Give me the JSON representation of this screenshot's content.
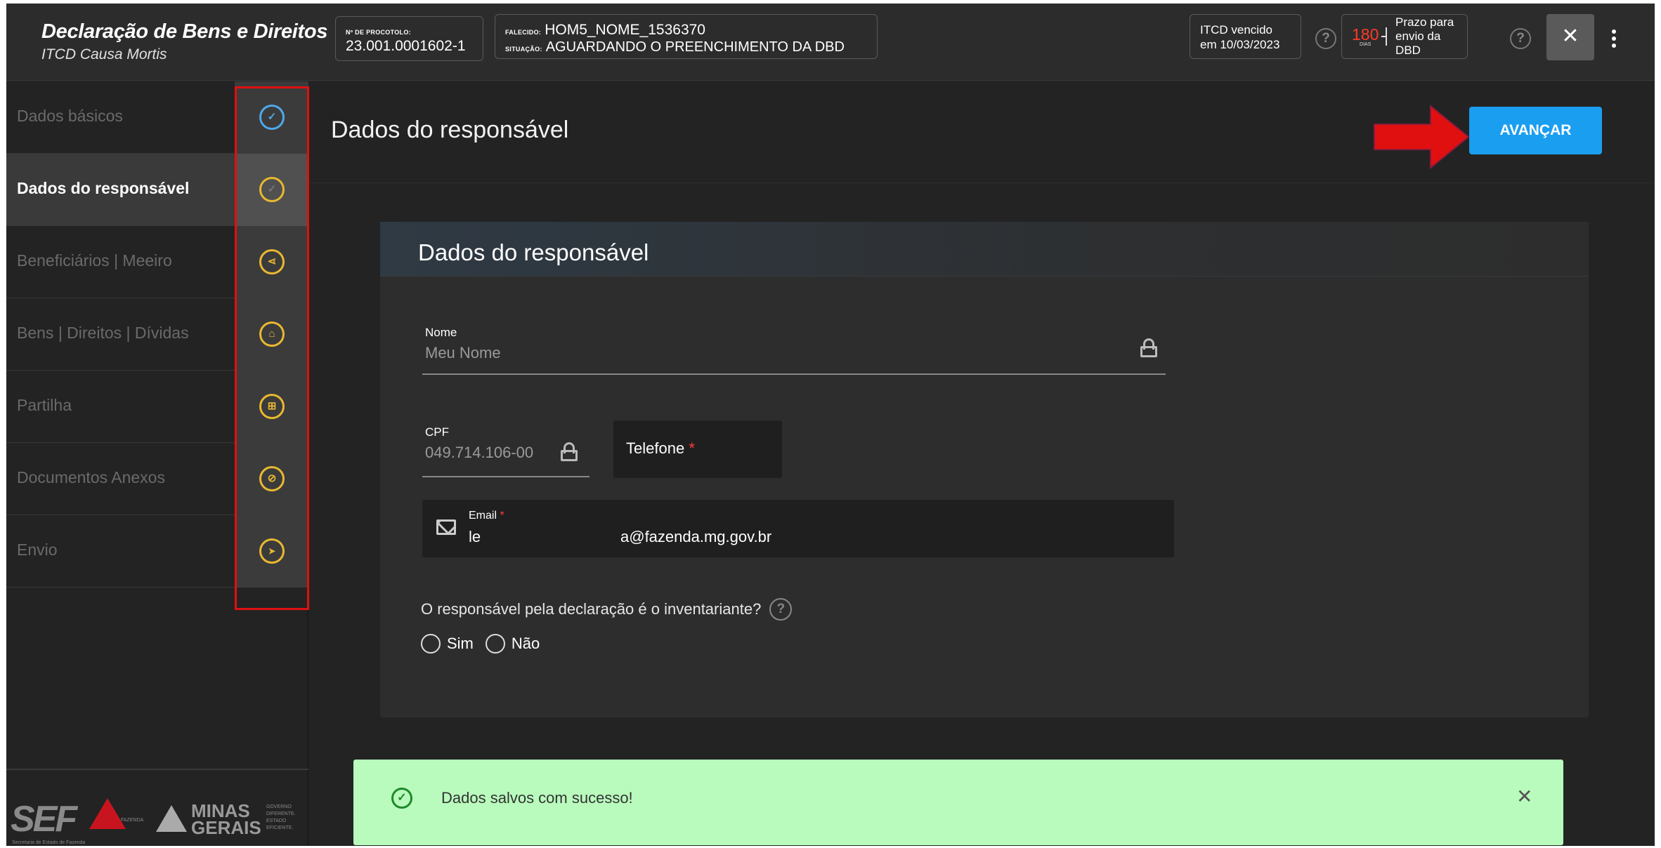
{
  "header": {
    "title": "Declaração de Bens e Direitos",
    "subtitle": "ITCD Causa Mortis",
    "protocol_label": "Nº DE PROCOTOLO:",
    "protocol_value": "23.001.0001602-1",
    "falecido_label": "FALECIDO:",
    "falecido_value": "HOM5_NOME_1536370",
    "situacao_label": "SITUAÇÃO:",
    "situacao_value": "AGUARDANDO O PREENCHIMENTO DA DBD",
    "itcd_line1": "ITCD vencido",
    "itcd_line2": "em 10/03/2023",
    "help_icon": "?",
    "prazo_days": "180",
    "prazo_days_unit": "DIAS",
    "prazo_line1": "Prazo para",
    "prazo_line2": "envio da DBD",
    "close_icon": "✕"
  },
  "sidebar": {
    "items": [
      {
        "label": "Dados básicos",
        "icon": "check-icon",
        "glyph": "✓",
        "state": "done"
      },
      {
        "label": "Dados do responsável",
        "icon": "check-icon",
        "glyph": "✓",
        "state": "active"
      },
      {
        "label": "Beneficiários | Meeiro",
        "icon": "share-icon",
        "glyph": "⋖",
        "state": "pending"
      },
      {
        "label": "Bens | Direitos | Dívidas",
        "icon": "house-icon",
        "glyph": "⌂",
        "state": "pending"
      },
      {
        "label": "Partilha",
        "icon": "grid-icon",
        "glyph": "⊞",
        "state": "pending"
      },
      {
        "label": "Documentos Anexos",
        "icon": "paperclip-icon",
        "glyph": "⊘",
        "state": "pending"
      },
      {
        "label": "Envio",
        "icon": "send-icon",
        "glyph": "➤",
        "state": "pending"
      }
    ],
    "logos": {
      "sef": "SEF",
      "sef_sub": "Secretaria de Estado de Fazenda",
      "fazenda": "FAZENDA",
      "mg_line1": "MINAS",
      "mg_line2": "GERAIS",
      "gov_line1": "GOVERNO",
      "gov_line2": "DIFERENTE.",
      "gov_line3": "ESTADO",
      "gov_line4": "EFICIENTE."
    }
  },
  "main": {
    "page_title": "Dados do responsável",
    "advance_button": "AVANÇAR",
    "card_title": "Dados do responsável",
    "nome_label": "Nome",
    "nome_value": "Meu Nome",
    "cpf_label": "CPF",
    "cpf_value": "049.714.106-00",
    "telefone_label": "Telefone",
    "required_mark": "*",
    "email_label": "Email",
    "email_value_start": "le",
    "email_value_end": "a@fazenda.mg.gov.br",
    "question": "O responsável pela declaração é o inventariante?",
    "option_yes": "Sim",
    "option_no": "Não"
  },
  "toast": {
    "message": "Dados salvos com sucesso!",
    "check_glyph": "✓",
    "close_glyph": "✕"
  },
  "colors": {
    "accent": "#1a9ef0",
    "done_icon": "#4ea8e8",
    "pending_icon": "#e8b830",
    "annotation": "#e01010",
    "toast_bg": "#b9fbbd"
  }
}
